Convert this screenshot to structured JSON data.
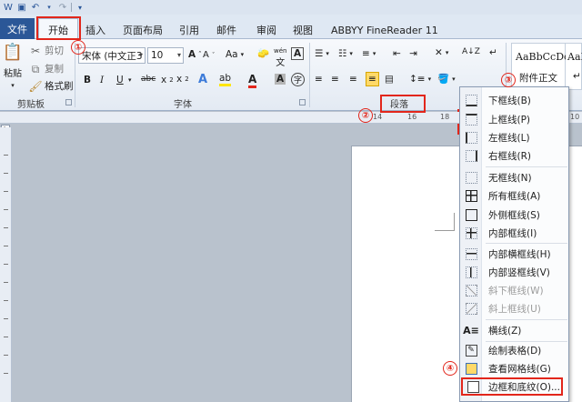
{
  "tabs": {
    "file": "文件",
    "items": [
      "开始",
      "插入",
      "页面布局",
      "引用",
      "邮件",
      "审阅",
      "视图",
      "ABBYY FineReader 11"
    ]
  },
  "clipboard": {
    "paste": "粘贴",
    "cut": "剪切",
    "copy": "复制",
    "format_painter": "格式刷",
    "group_label": "剪贴板"
  },
  "font": {
    "font_name": "宋体 (中文正3",
    "font_size": "10",
    "change_case": "Aa",
    "wen": "wén",
    "group_label": "字体"
  },
  "paragraph": {
    "group_label": "段落"
  },
  "styles": {
    "sample1": "AaBbCcDc",
    "sample2": "AaI",
    "name1": "附件正文",
    "name2": "↵"
  },
  "ruler": {
    "numbers": [
      "14",
      "16",
      "18",
      "10"
    ]
  },
  "borders_menu": {
    "items": [
      {
        "label": "下框线(B)",
        "icon": "bottom-border-icon",
        "disabled": false
      },
      {
        "label": "上框线(P)",
        "icon": "top-border-icon",
        "disabled": false
      },
      {
        "label": "左框线(L)",
        "icon": "left-border-icon",
        "disabled": false
      },
      {
        "label": "右框线(R)",
        "icon": "right-border-icon",
        "disabled": false
      },
      {
        "label": "无框线(N)",
        "icon": "no-border-icon",
        "disabled": false
      },
      {
        "label": "所有框线(A)",
        "icon": "all-borders-icon",
        "disabled": false
      },
      {
        "label": "外侧框线(S)",
        "icon": "outside-borders-icon",
        "disabled": false
      },
      {
        "label": "内部框线(I)",
        "icon": "inside-borders-icon",
        "disabled": false
      },
      {
        "label": "内部横框线(H)",
        "icon": "inside-horizontal-border-icon",
        "disabled": false
      },
      {
        "label": "内部竖框线(V)",
        "icon": "inside-vertical-border-icon",
        "disabled": false
      },
      {
        "label": "斜下框线(W)",
        "icon": "diagonal-down-border-icon",
        "disabled": true
      },
      {
        "label": "斜上框线(U)",
        "icon": "diagonal-up-border-icon",
        "disabled": true
      },
      {
        "label": "横线(Z)",
        "icon": "horizontal-line-icon",
        "disabled": false
      },
      {
        "label": "绘制表格(D)",
        "icon": "draw-table-icon",
        "disabled": false
      },
      {
        "label": "查看网格线(G)",
        "icon": "view-gridlines-icon",
        "disabled": false
      },
      {
        "label": "边框和底纹(O)...",
        "icon": "borders-shading-icon",
        "disabled": false
      }
    ]
  },
  "annotations": [
    "①",
    "②",
    "③",
    "④"
  ],
  "colors": {
    "accent_red": "#e2261b",
    "file_tab": "#2b5797",
    "highlight": "#ffd968"
  }
}
